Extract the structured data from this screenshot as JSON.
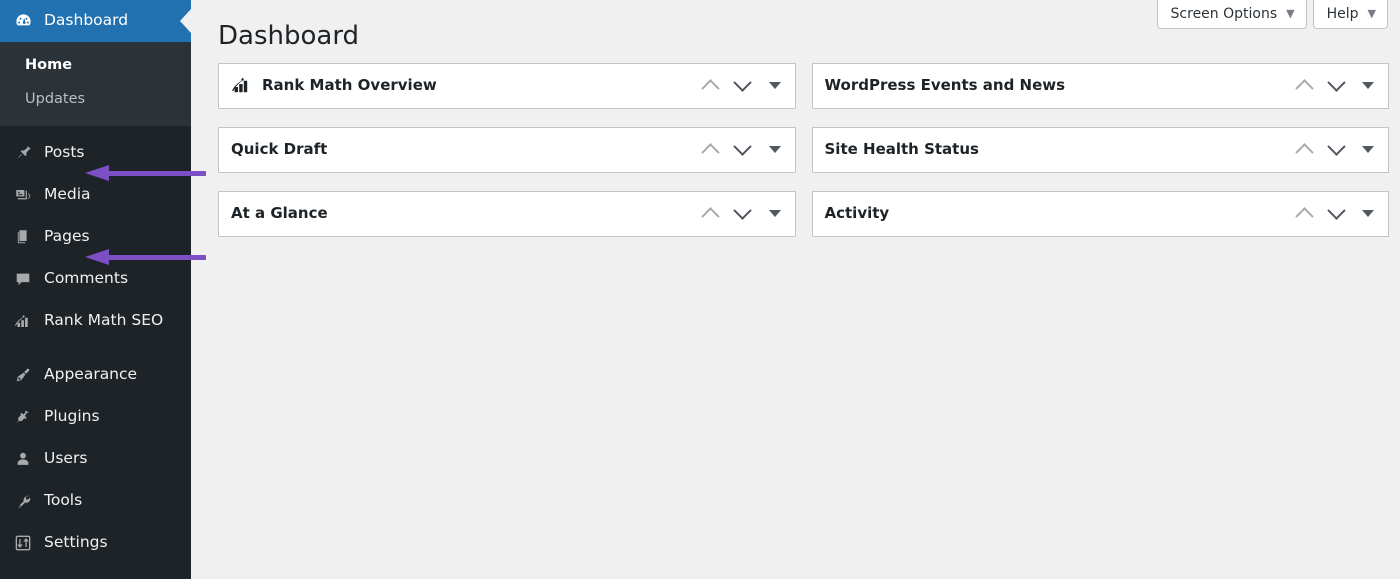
{
  "colors": {
    "sidebar_bg": "#1d2327",
    "submenu_bg": "#2c3338",
    "active_blue": "#2271b1",
    "content_bg": "#f0f0f1",
    "annotation_purple": "#7d4fc4",
    "widget_border": "#c3c4c7"
  },
  "sidebar": {
    "items": [
      {
        "label": "Dashboard",
        "icon": "dashboard-icon",
        "current": true
      },
      {
        "label": "Posts",
        "icon": "pin-icon",
        "current": false
      },
      {
        "label": "Media",
        "icon": "media-icon",
        "current": false
      },
      {
        "label": "Pages",
        "icon": "pages-icon",
        "current": false
      },
      {
        "label": "Comments",
        "icon": "comments-icon",
        "current": false
      },
      {
        "label": "Rank Math SEO",
        "icon": "rank-math-icon",
        "current": false
      },
      {
        "label": "Appearance",
        "icon": "appearance-brush-icon",
        "current": false
      },
      {
        "label": "Plugins",
        "icon": "plugins-plug-icon",
        "current": false
      },
      {
        "label": "Users",
        "icon": "users-icon",
        "current": false
      },
      {
        "label": "Tools",
        "icon": "tools-wrench-icon",
        "current": false
      },
      {
        "label": "Settings",
        "icon": "settings-sliders-icon",
        "current": false
      }
    ],
    "submenu": [
      {
        "label": "Home",
        "current": true
      },
      {
        "label": "Updates",
        "current": false
      }
    ]
  },
  "screen_meta": {
    "screen_options_label": "Screen Options",
    "help_label": "Help",
    "caret": "▼"
  },
  "page": {
    "title": "Dashboard"
  },
  "widgets": {
    "left": [
      {
        "title": "Rank Math Overview",
        "has_icon": true
      },
      {
        "title": "Quick Draft",
        "has_icon": false
      },
      {
        "title": "At a Glance",
        "has_icon": false
      }
    ],
    "right": [
      {
        "title": "WordPress Events and News",
        "has_icon": false
      },
      {
        "title": "Site Health Status",
        "has_icon": false
      },
      {
        "title": "Activity",
        "has_icon": false
      }
    ]
  },
  "annotations": [
    {
      "target": "Posts",
      "direction": "left"
    },
    {
      "target": "Pages",
      "direction": "left"
    }
  ]
}
